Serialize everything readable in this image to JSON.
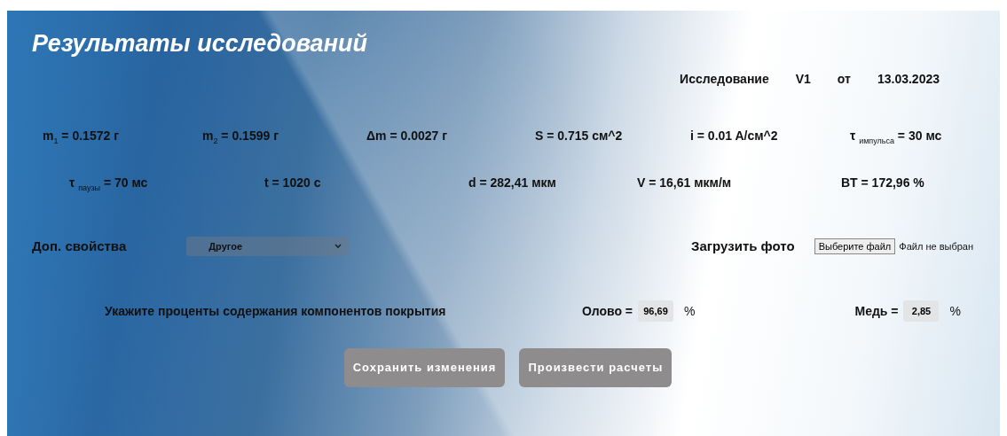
{
  "title": "Результаты исследований",
  "study": {
    "label": "Исследование",
    "version": "V1",
    "separator": "от",
    "date": "13.03.2023"
  },
  "metrics_row_1": [
    "m$_{1}$ = 0.1572 г",
    "m$_{2}$ = 0.1599 г",
    "Δm = 0.0027 г",
    "S = 0.715 см^2",
    "i = 0.01 A/см^2",
    "τ $_{импульса}$ = 30 мс"
  ],
  "metrics_row_2": [
    "τ $_{паузы}$ = 70 мс",
    "t = 1020 с",
    "d = 282,41 мкм",
    "V = 16,61 мкм/м",
    "BT = 172,96 %"
  ],
  "extra_properties": {
    "label": "Доп. свойства",
    "value": "Другое"
  },
  "photo_upload": {
    "label": "Загрузить фото",
    "button": "Выберите файл",
    "status": "Файл не выбран"
  },
  "composition": {
    "prompt": "Укажите проценты содержания компонентов покрытия",
    "components": [
      {
        "name": "Олово =",
        "value": "96,69",
        "unit": "%"
      },
      {
        "name": "Медь =",
        "value": "2,85",
        "unit": "%"
      }
    ]
  },
  "buttons": [
    "Сохранить изменения",
    "Произвести расчеты"
  ]
}
